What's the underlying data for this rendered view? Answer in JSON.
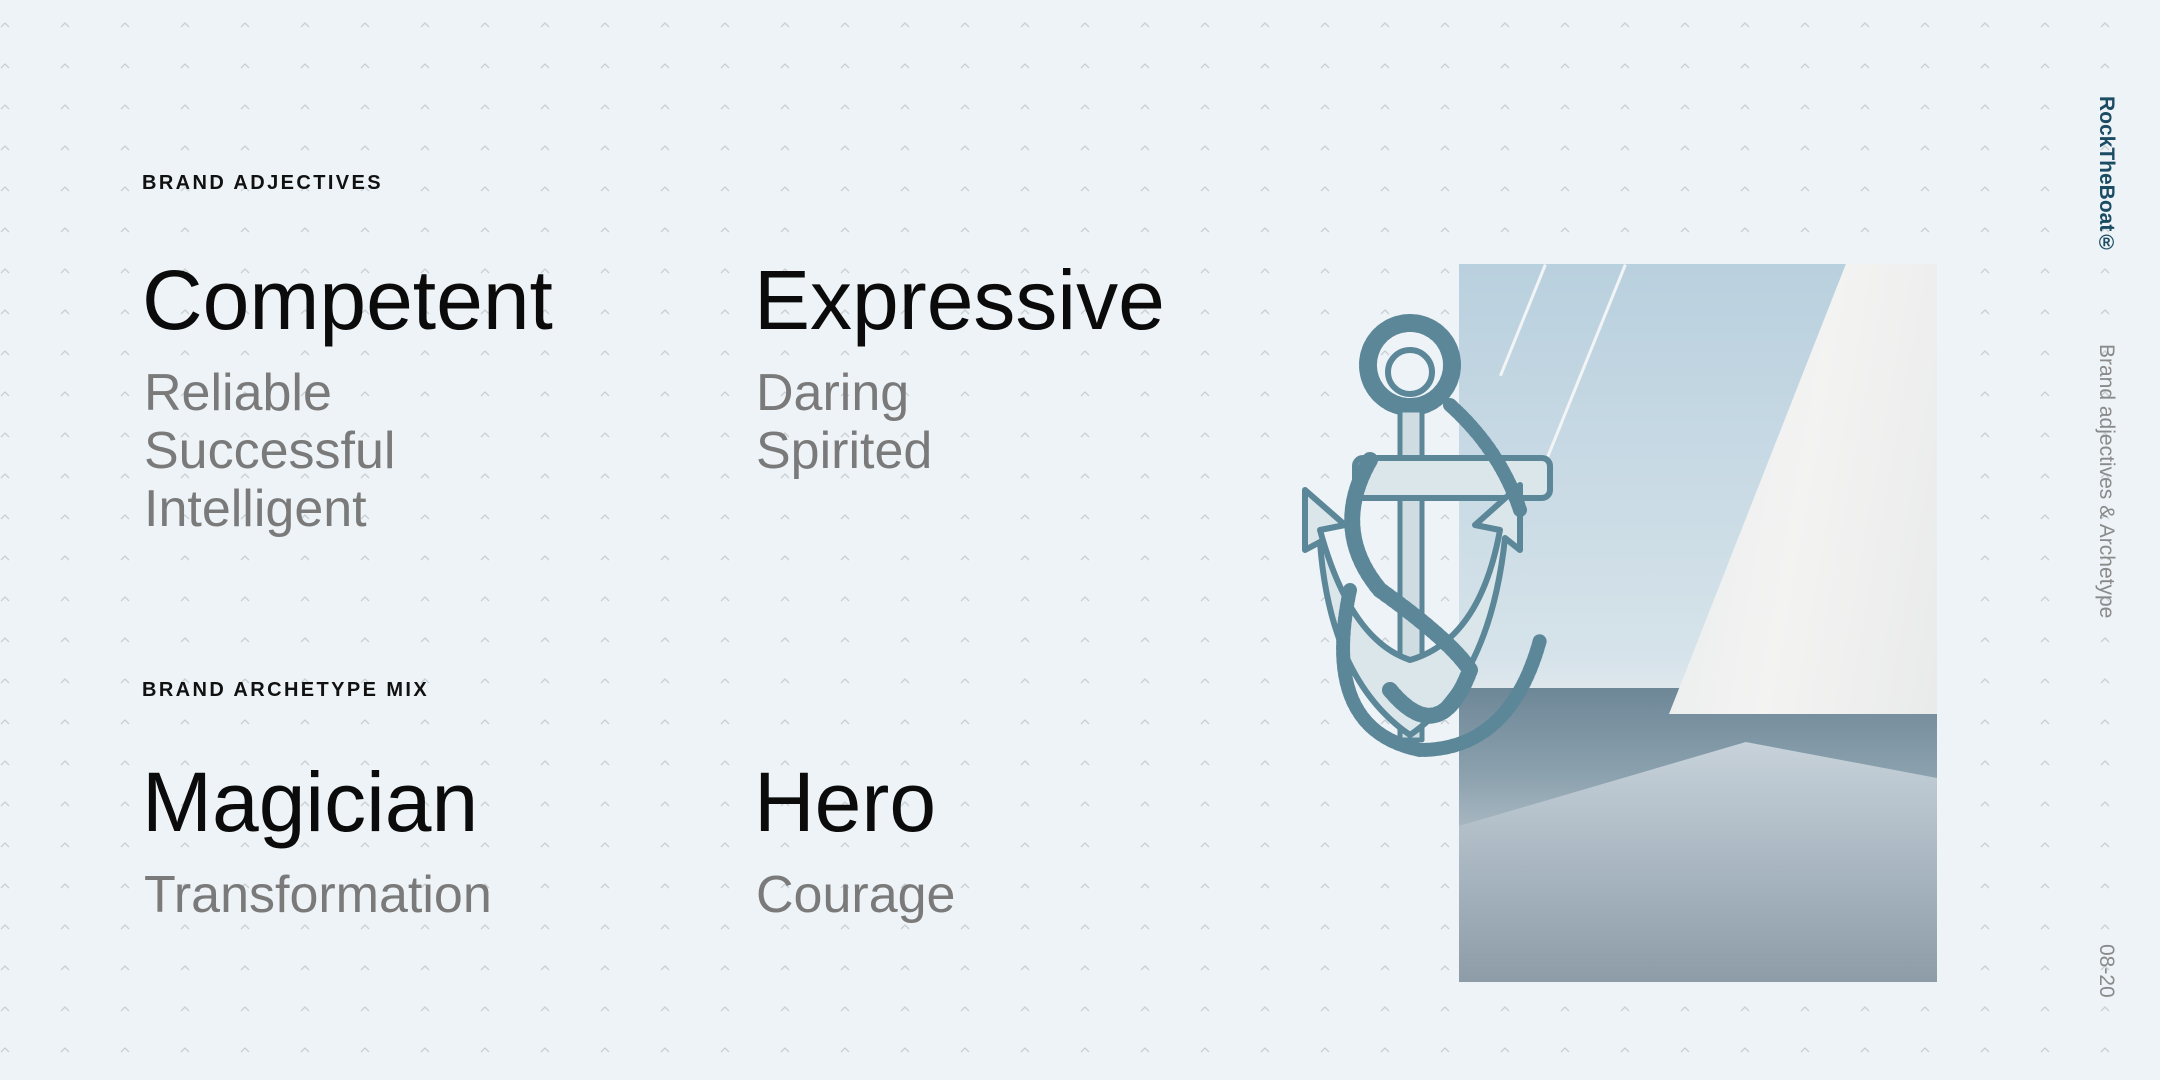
{
  "sidebar": {
    "brand": "RockTheBoat®",
    "title": "Brand adjectives & Archetype",
    "page": "08-20"
  },
  "adjectives": {
    "heading": "BRAND ADJECTIVES",
    "columns": [
      {
        "title": "Competent",
        "items": [
          "Reliable",
          "Successful",
          "Intelligent"
        ]
      },
      {
        "title": "Expressive",
        "items": [
          "Daring",
          "Spirited"
        ]
      }
    ]
  },
  "archetype": {
    "heading": "BRAND ARCHETYPE MIX",
    "columns": [
      {
        "title": "Magician",
        "items": [
          "Transformation"
        ]
      },
      {
        "title": "Hero",
        "items": [
          "Courage"
        ]
      }
    ]
  },
  "colors": {
    "background": "#edf3f6",
    "brand": "#1b4c63",
    "anchor": "#5b8799"
  }
}
